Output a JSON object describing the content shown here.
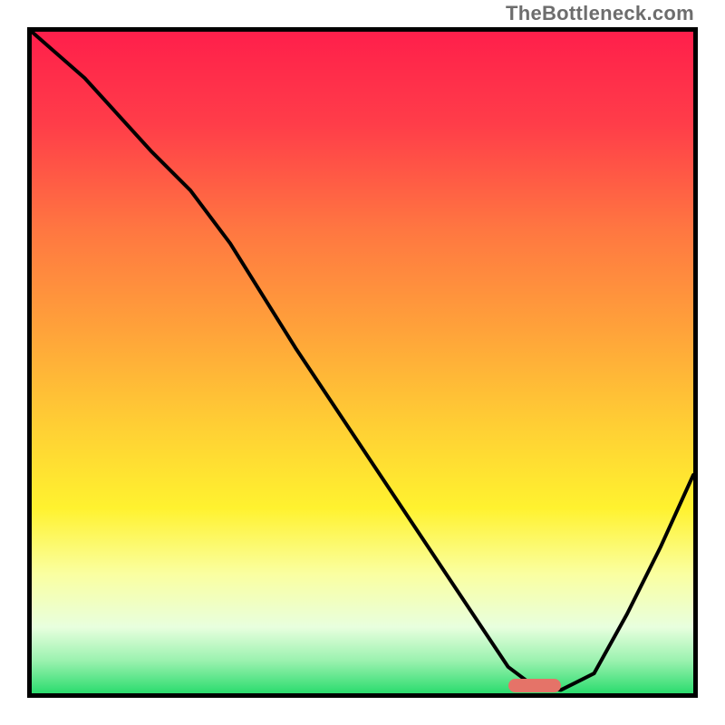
{
  "watermark": "TheBottleneck.com",
  "chart_data": {
    "type": "line",
    "title": "",
    "xlabel": "",
    "ylabel": "",
    "xlim": [
      0,
      100
    ],
    "ylim": [
      0,
      100
    ],
    "grid": false,
    "legend": false,
    "background_gradient": {
      "stops": [
        {
          "pct": 0,
          "color": "#ff1f4b"
        },
        {
          "pct": 14,
          "color": "#ff3d49"
        },
        {
          "pct": 30,
          "color": "#ff7741"
        },
        {
          "pct": 45,
          "color": "#ffa23a"
        },
        {
          "pct": 60,
          "color": "#ffd034"
        },
        {
          "pct": 72,
          "color": "#fff22f"
        },
        {
          "pct": 82,
          "color": "#faffa1"
        },
        {
          "pct": 90,
          "color": "#e8ffde"
        },
        {
          "pct": 95,
          "color": "#9cf2b0"
        },
        {
          "pct": 100,
          "color": "#2bdc6e"
        }
      ]
    },
    "series": [
      {
        "name": "bottleneck-curve",
        "x": [
          0,
          8,
          18,
          24,
          30,
          40,
          50,
          60,
          68,
          72,
          76,
          80,
          85,
          90,
          95,
          100
        ],
        "y": [
          100,
          93,
          82,
          76,
          68,
          52,
          37,
          22,
          10,
          4,
          1,
          0.5,
          3,
          12,
          22,
          33
        ]
      }
    ],
    "marker": {
      "x": 76,
      "y": 0,
      "color": "#e57368",
      "shape": "rounded-rect"
    }
  }
}
